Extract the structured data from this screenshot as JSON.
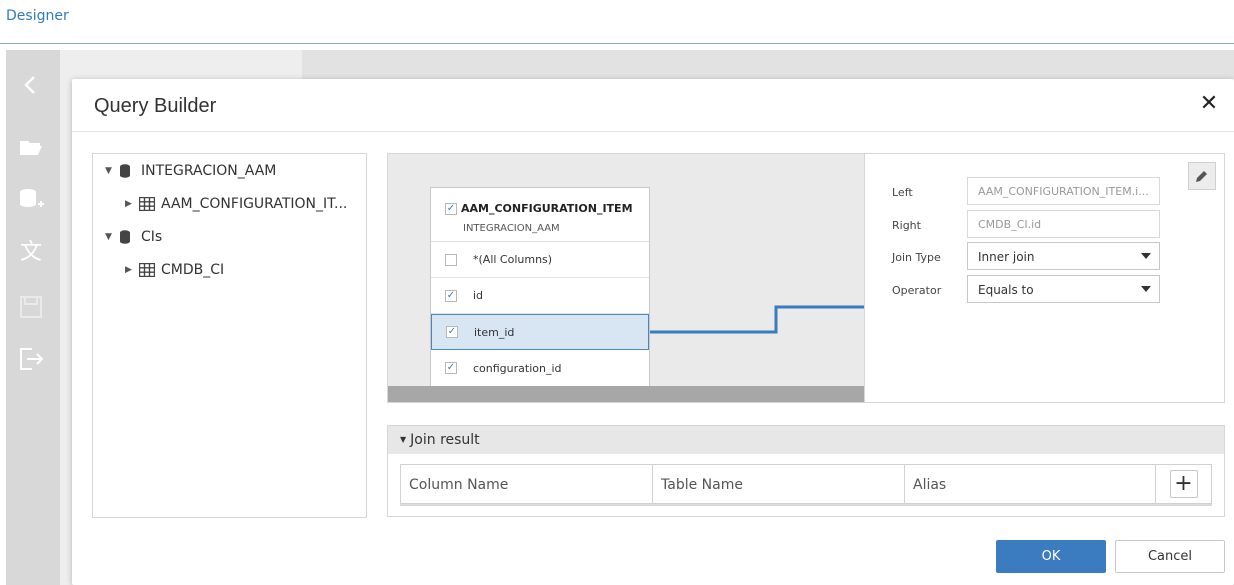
{
  "app": {
    "designer_link": "Designer"
  },
  "sidebar": {
    "icons": [
      "back-icon",
      "open-folder-icon",
      "add-datasource-icon",
      "translate-icon",
      "save-icon",
      "exit-icon"
    ]
  },
  "dialog": {
    "title": "Query Builder",
    "close": "✕"
  },
  "tree": {
    "items": [
      {
        "label": "INTEGRACION_AAM",
        "type": "database",
        "expanded": true
      },
      {
        "label": "AAM_CONFIGURATION_IT...",
        "type": "table",
        "expanded": false
      },
      {
        "label": "CIs",
        "type": "database",
        "expanded": true
      },
      {
        "label": "CMDB_CI",
        "type": "table",
        "expanded": false
      }
    ]
  },
  "diagram": {
    "table": {
      "name": "AAM_CONFIGURATION_ITEM",
      "source": "INTEGRACION_AAM",
      "columns": [
        {
          "label": "*(All Columns)",
          "checked": false,
          "selected": false
        },
        {
          "label": "id",
          "checked": true,
          "selected": false
        },
        {
          "label": "item_id",
          "checked": true,
          "selected": true
        },
        {
          "label": "configuration_id",
          "checked": true,
          "selected": false
        }
      ]
    }
  },
  "join_props": {
    "left_label": "Left",
    "left_value": "AAM_CONFIGURATION_ITEM.i...",
    "right_label": "Right",
    "right_value": "CMDB_CI.id",
    "join_type_label": "Join Type",
    "join_type_value": "Inner join",
    "operator_label": "Operator",
    "operator_value": "Equals to"
  },
  "join_result": {
    "title": "Join result",
    "columns": [
      "Column Name",
      "Table Name",
      "Alias"
    ],
    "add_label": "+"
  },
  "footer": {
    "ok": "OK",
    "cancel": "Cancel"
  },
  "colors": {
    "accent": "#3b7bbf",
    "connector": "#3b7bbf",
    "selected_row": "#d8e6f4"
  }
}
